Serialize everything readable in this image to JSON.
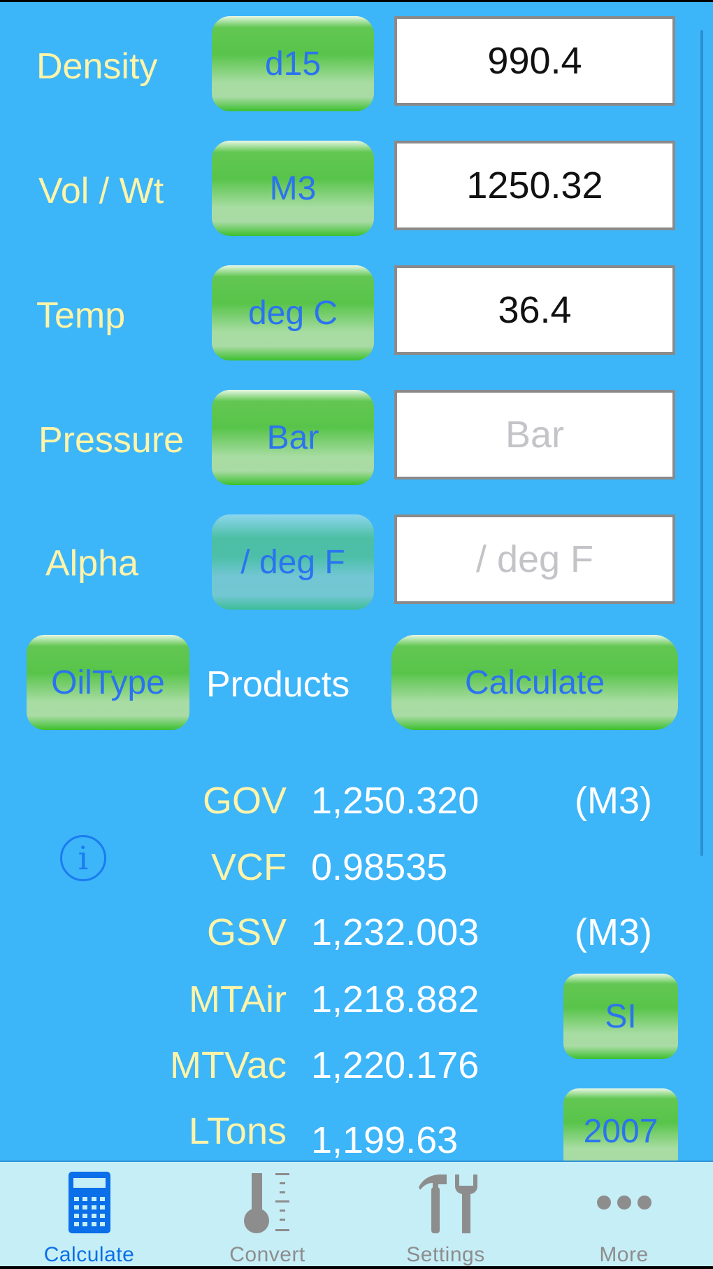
{
  "inputs": [
    {
      "label": "Density",
      "unit_button": "d15",
      "value": "990.4",
      "placeholder": ""
    },
    {
      "label": "Vol / Wt",
      "unit_button": "M3",
      "value": "1250.32",
      "placeholder": ""
    },
    {
      "label": "Temp",
      "unit_button": "deg C",
      "value": "36.4",
      "placeholder": ""
    },
    {
      "label": "Pressure",
      "unit_button": "Bar",
      "value": "",
      "placeholder": "Bar"
    },
    {
      "label": "Alpha",
      "unit_button": "/ deg F",
      "value": "",
      "placeholder": "/ deg F"
    }
  ],
  "actions": {
    "oiltype_label": "OilType",
    "oiltype_value": "Products",
    "calculate_label": "Calculate"
  },
  "results": [
    {
      "label": "GOV",
      "value": "1,250.320",
      "unit": "(M3)"
    },
    {
      "label": "VCF",
      "value": "0.98535",
      "unit": ""
    },
    {
      "label": "GSV",
      "value": "1,232.003",
      "unit": "(M3)"
    },
    {
      "label": "MTAir",
      "value": "1,218.882",
      "unit": ""
    },
    {
      "label": "MTVac",
      "value": "1,220.176",
      "unit": ""
    },
    {
      "label": "LTons",
      "value": "1,199.63",
      "unit": ""
    }
  ],
  "side_buttons": {
    "si": "SI",
    "year": "2007"
  },
  "info_glyph": "i",
  "tabs": [
    {
      "label": "Calculate",
      "icon": "calculator-icon",
      "active": true
    },
    {
      "label": "Convert",
      "icon": "thermometer-icon",
      "active": false
    },
    {
      "label": "Settings",
      "icon": "tools-icon",
      "active": false
    },
    {
      "label": "More",
      "icon": "more-dots-icon",
      "active": false
    }
  ],
  "colors": {
    "background": "#3db5f9",
    "label": "#fff4a8",
    "button_text": "#2a73f0",
    "tab_active": "#0a6fe8",
    "tab_inactive": "#8d8d8d"
  }
}
